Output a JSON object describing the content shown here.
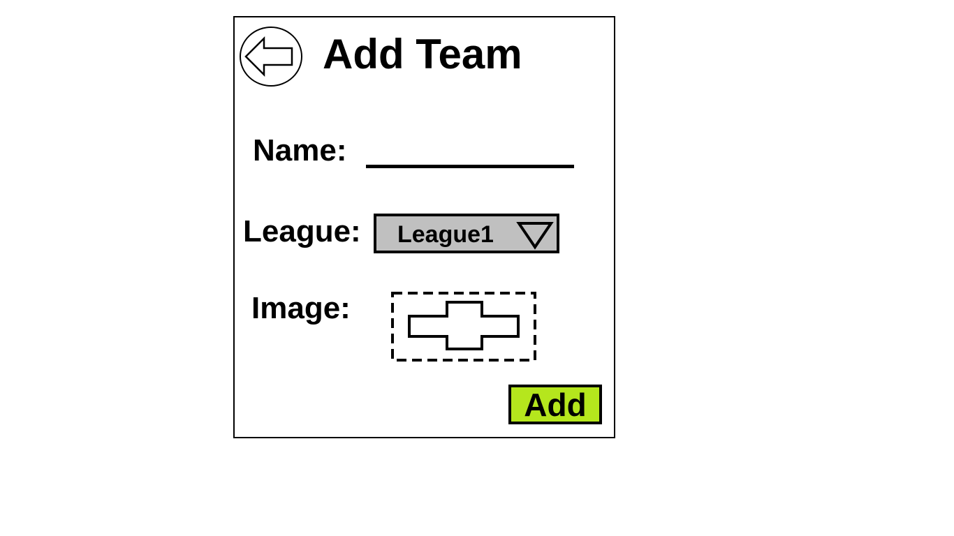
{
  "page": {
    "title": "Add Team"
  },
  "icons": {
    "back": "back-arrow-icon",
    "dropdown": "chevron-down-icon",
    "image_placeholder": "image-placeholder-icon"
  },
  "form": {
    "name_label": "Name:",
    "name_value": "",
    "league_label": "League:",
    "league_selected": "League1",
    "image_label": "Image:",
    "add_label": "Add"
  },
  "colors": {
    "add_button": "#b5e61d",
    "select_bg": "#c0c0c0"
  }
}
